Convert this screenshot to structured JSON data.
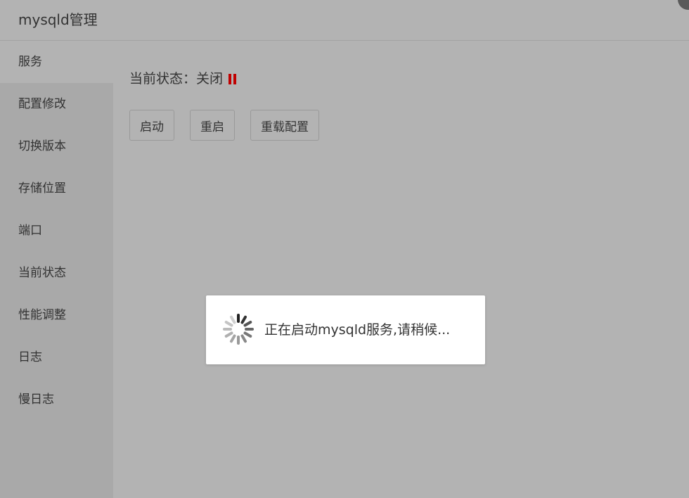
{
  "window": {
    "title": "mysqld管理"
  },
  "sidebar": {
    "items": [
      {
        "label": "服务",
        "active": true
      },
      {
        "label": "配置修改"
      },
      {
        "label": "切换版本"
      },
      {
        "label": "存储位置"
      },
      {
        "label": "端口"
      },
      {
        "label": "当前状态"
      },
      {
        "label": "性能调整"
      },
      {
        "label": "日志"
      },
      {
        "label": "慢日志"
      }
    ]
  },
  "main": {
    "status_label": "当前状态：",
    "status_value": "关闭",
    "status_icon": "pause-icon",
    "status_icon_color": "#c00000",
    "buttons": {
      "start": "启动",
      "restart": "重启",
      "reload_config": "重载配置"
    }
  },
  "loading_dialog": {
    "icon": "spinner-icon",
    "message": "正在启动mysqld服务,请稍候..."
  }
}
